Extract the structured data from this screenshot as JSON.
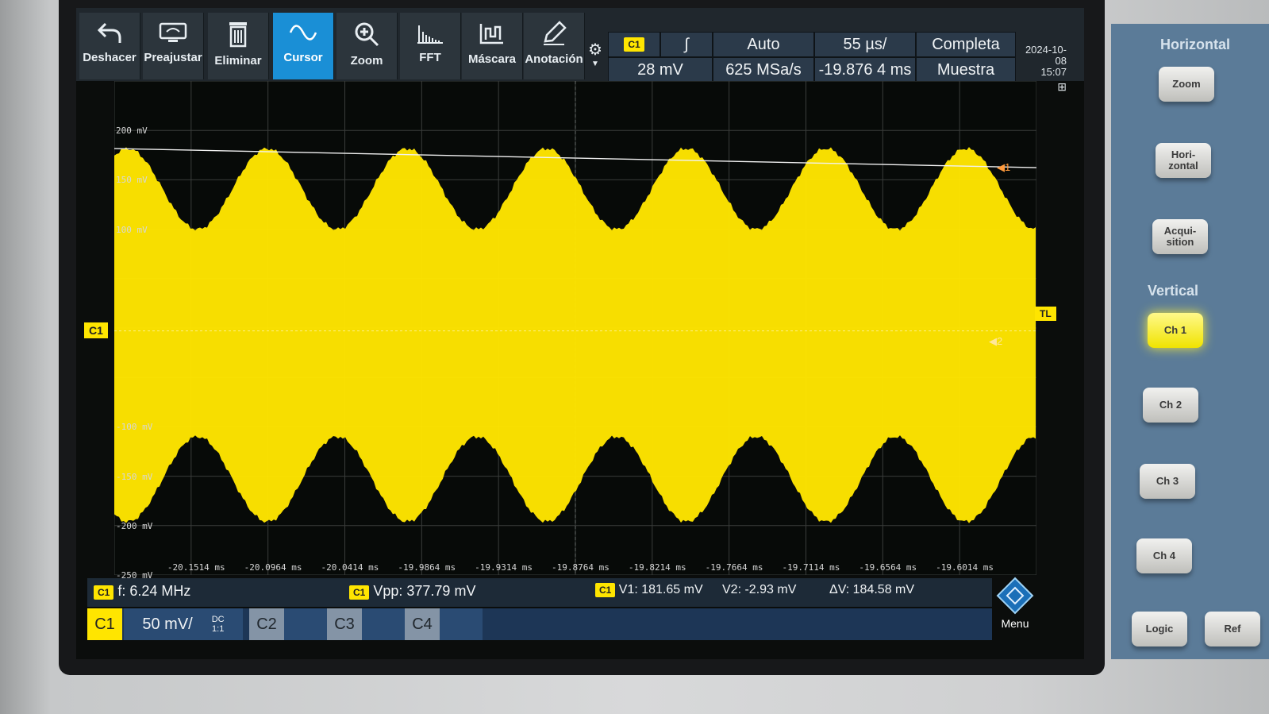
{
  "toolbar": {
    "undo": "Deshacer",
    "preset": "Preajustar",
    "delete": "Eliminar",
    "cursor": "Cursor",
    "zoom": "Zoom",
    "fft": "FFT",
    "mask": "Máscara",
    "annotation": "Anotación"
  },
  "trigger": {
    "source": "C1",
    "slope_symbol": "∫",
    "mode": "Auto",
    "level": "28 mV"
  },
  "acquisition": {
    "timebase": "55 µs/",
    "sample_rate": "625 MSa/s",
    "position": "-19.876 4 ms",
    "record": "Completa",
    "mode": "Muestra"
  },
  "datetime": {
    "date": "2024-10-08",
    "time": "15:07"
  },
  "y_ticks": [
    "200 mV",
    "150 mV",
    "100 mV",
    "-100 mV",
    "-150 mV",
    "-200 mV",
    "-250 mV"
  ],
  "x_ticks": [
    "-20.1514 ms",
    "-20.0964 ms",
    "-20.0414 ms",
    "-19.9864 ms",
    "-19.9314 ms",
    "-19.8764 ms",
    "-19.8214 ms",
    "-19.7664 ms",
    "-19.7114 ms",
    "-19.6564 ms",
    "-19.6014 ms"
  ],
  "markers": {
    "channel": "C1",
    "trigger_level": "TL",
    "cursor1": "1",
    "cursor2": "2"
  },
  "measurements": {
    "badge": "C1",
    "freq": "f: 6.24 MHz",
    "vpp": "Vpp: 377.79 mV",
    "v1": "V1: 181.65 mV",
    "v2": "V2: -2.93 mV",
    "dv": "ΔV: 184.58 mV"
  },
  "channels": {
    "c1_label": "C1",
    "c1_scale": "50 mV/",
    "c1_coupling": "DC",
    "c1_probe": "1:1",
    "c2_label": "C2",
    "c3_label": "C3",
    "c4_label": "C4"
  },
  "menu_label": "Menu",
  "panel": {
    "horizontal_title": "Horizontal",
    "zoom": "Zoom",
    "horizontal": "Hori-\nzontal",
    "acquisition": "Acqui-\nsition",
    "vertical_title": "Vertical",
    "ch1": "Ch 1",
    "ch2": "Ch 2",
    "ch3": "Ch 3",
    "ch4": "Ch 4",
    "logic": "Logic",
    "ref": "Ref"
  },
  "colors": {
    "trace": "#ffe500",
    "active_tool": "#1a8fd6"
  },
  "waveform": {
    "envelope_cycles": 6.6,
    "upper_peak_mv": 181.65,
    "upper_trough_mv": 100,
    "lower_peak_mv": -196,
    "lower_trough_mv": -110
  }
}
